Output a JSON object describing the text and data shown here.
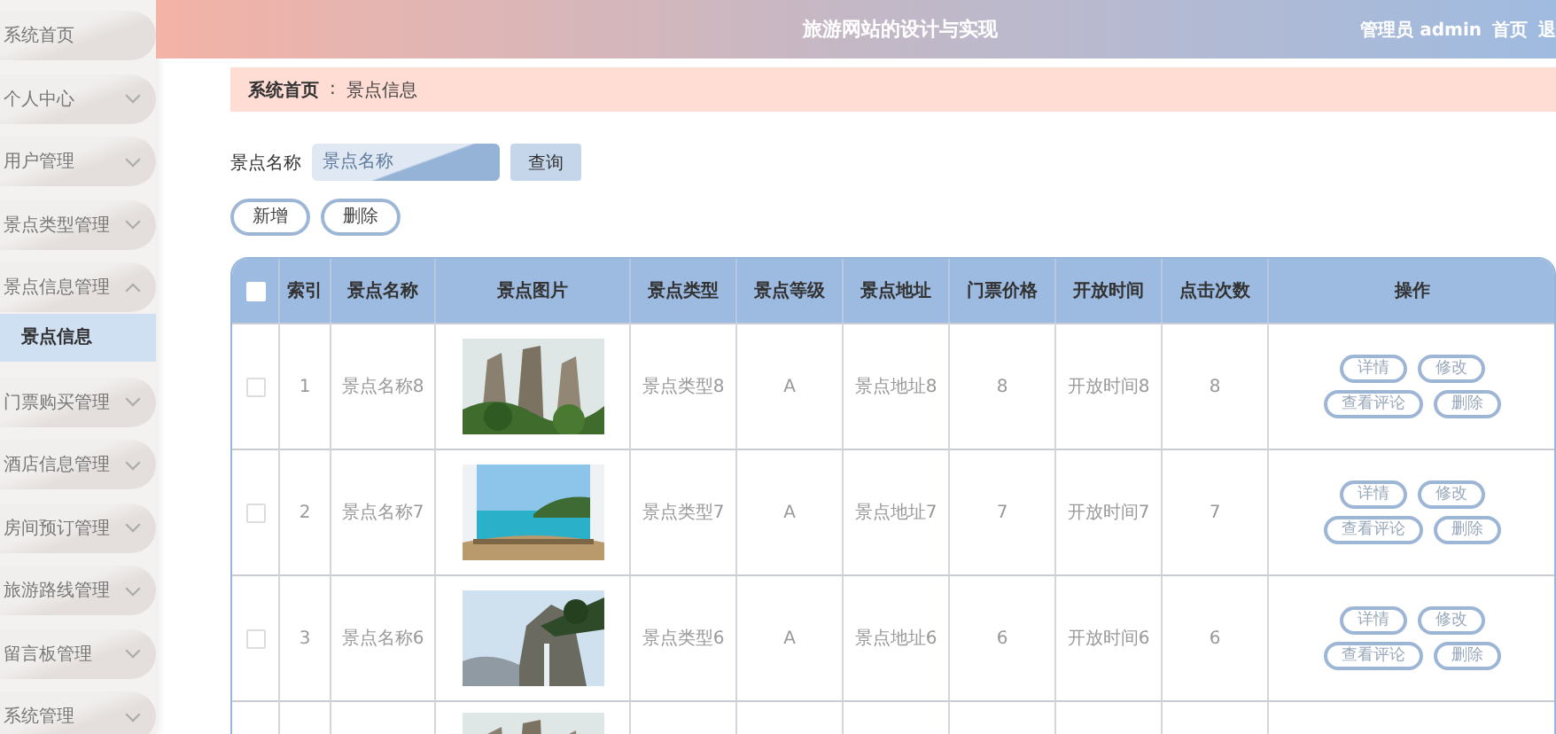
{
  "header": {
    "title": "旅游网站的设计与实现",
    "user": "管理员 admin",
    "links": [
      "首页",
      "退"
    ]
  },
  "sidebar": {
    "items": [
      {
        "label": "系统首页"
      },
      {
        "label": "个人中心",
        "expanded": false
      },
      {
        "label": "用户管理",
        "expanded": false
      },
      {
        "label": "景点类型管理",
        "expanded": false
      },
      {
        "label": "景点信息管理",
        "expanded": true,
        "children": [
          {
            "label": "景点信息",
            "selected": true
          }
        ]
      },
      {
        "label": "门票购买管理",
        "expanded": false
      },
      {
        "label": "酒店信息管理",
        "expanded": false
      },
      {
        "label": "房间预订管理",
        "expanded": false
      },
      {
        "label": "旅游路线管理",
        "expanded": false
      },
      {
        "label": "留言板管理",
        "expanded": false
      },
      {
        "label": "系统管理",
        "expanded": false
      }
    ]
  },
  "breadcrumb": [
    "系统首页",
    "景点信息"
  ],
  "breadcrumb_separator": ":",
  "search": {
    "label": "景点名称",
    "placeholder": "景点名称",
    "button": "查询"
  },
  "actions": [
    "新增",
    "删除"
  ],
  "table": {
    "select_all": {
      "checked": false
    },
    "columns": [
      "索引",
      "景点名称",
      "景点图片",
      "景点类型",
      "景点等级",
      "景点地址",
      "门票价格",
      "开放时间",
      "点击次数",
      "操作"
    ],
    "rows": [
      {
        "checked": false,
        "index": "1",
        "name": "景点名称8",
        "picture": {
          "kind": "picture"
        },
        "type": "景点类型8",
        "level": "A",
        "address": "景点地址8",
        "price": "8",
        "open_time": "开放时间8",
        "clicks": "8",
        "buttons": [
          "详情",
          "修改",
          "查看评论",
          "删除"
        ]
      },
      {
        "checked": false,
        "index": "2",
        "name": "景点名称7",
        "picture": {
          "kind": "picture"
        },
        "type": "景点类型7",
        "level": "A",
        "address": "景点地址7",
        "price": "7",
        "open_time": "开放时间7",
        "clicks": "7",
        "buttons": [
          "详情",
          "修改",
          "查看评论",
          "删除"
        ]
      },
      {
        "checked": false,
        "index": "3",
        "name": "景点名称6",
        "picture": {
          "kind": "picture"
        },
        "type": "景点类型6",
        "level": "A",
        "address": "景点地址6",
        "price": "6",
        "open_time": "开放时间6",
        "clicks": "6",
        "buttons": [
          "详情",
          "修改",
          "查看评论",
          "删除"
        ]
      }
    ],
    "partial_row": {
      "picture": {
        "kind": "picture"
      }
    }
  }
}
